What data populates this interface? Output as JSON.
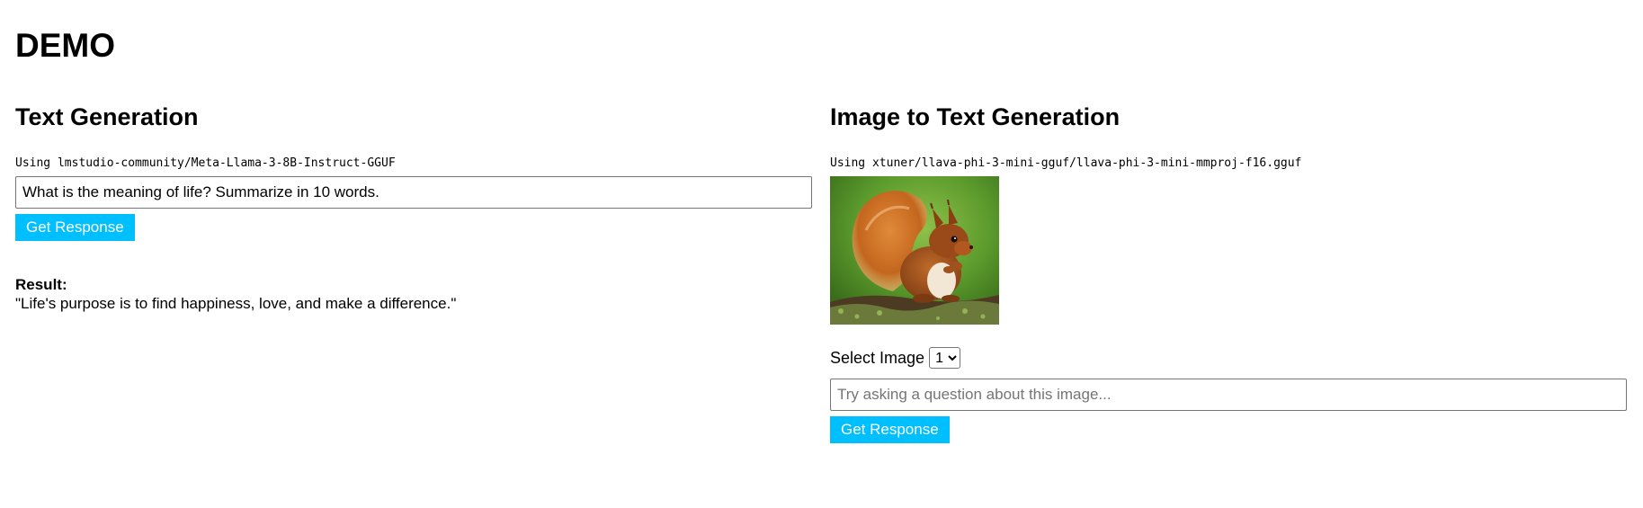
{
  "page": {
    "title": "DEMO"
  },
  "text_generation": {
    "heading": "Text Generation",
    "model_line": "Using lmstudio-community/Meta-Llama-3-8B-Instruct-GGUF",
    "prompt_value": "What is the meaning of life? Summarize in 10 words.",
    "button_label": "Get Response",
    "result_label": "Result:",
    "result_text": "\"Life's purpose is to find happiness, love, and make a difference.\""
  },
  "image_to_text": {
    "heading": "Image to Text Generation",
    "model_line": "Using xtuner/llava-phi-3-mini-gguf/llava-phi-3-mini-mmproj-f16.gguf",
    "image_subject": "squirrel",
    "select_label": "Select Image",
    "select_value": "1",
    "question_placeholder": "Try asking a question about this image...",
    "question_value": "",
    "button_label": "Get Response"
  },
  "colors": {
    "button_bg": "#00bfff",
    "button_text": "#ffffff"
  }
}
